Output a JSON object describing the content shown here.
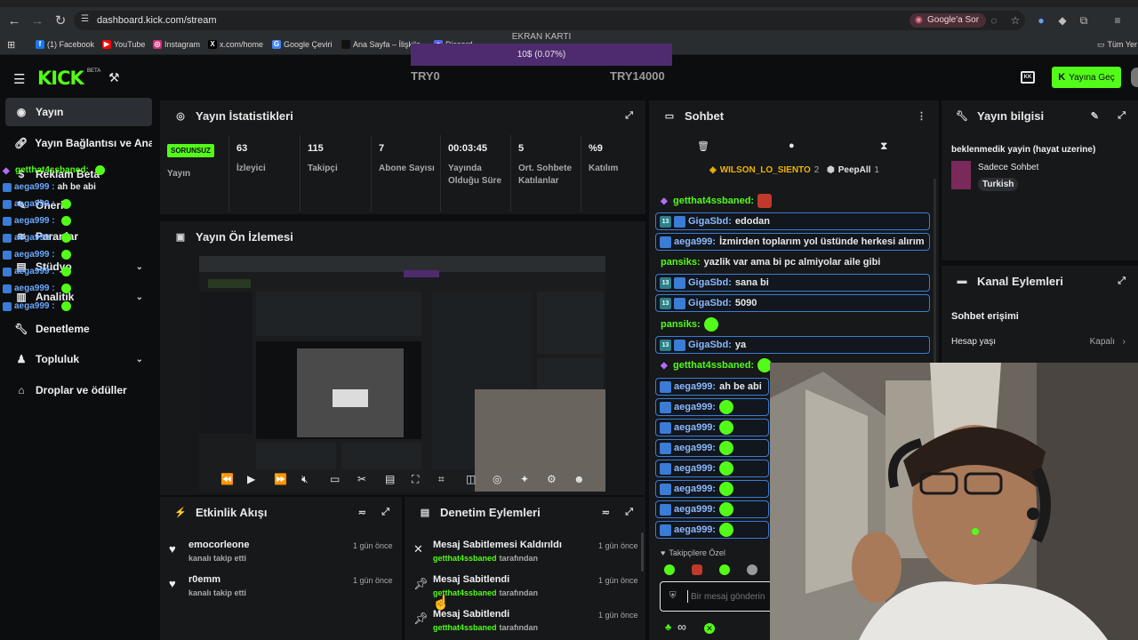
{
  "browser": {
    "url": "dashboard.kick.com/stream",
    "ask_google": "Google'a Sor",
    "bookmarks": [
      {
        "label": "(1) Facebook",
        "color": "#1877f2",
        "glyph": "f"
      },
      {
        "label": "YouTube",
        "color": "#ff0000",
        "glyph": "▶"
      },
      {
        "label": "Instagram",
        "color": "#d62976",
        "glyph": "◎"
      },
      {
        "label": "x.com/home",
        "color": "#000000",
        "glyph": "X"
      },
      {
        "label": "Google Çeviri",
        "color": "#4285f4",
        "glyph": "G"
      },
      {
        "label": "Ana Sayfa – İlişkile...",
        "color": "#111111",
        "glyph": ""
      },
      {
        "label": "Discord",
        "color": "#5865f2",
        "glyph": "●"
      }
    ],
    "all_bookmarks": "Tüm Yer"
  },
  "overlay": {
    "gpu_title": "EKRAN KARTI",
    "gpu_value": "10$ (0.07%)",
    "gpu_progress": 0.0007,
    "min": "TRY0",
    "max": "TRY14000"
  },
  "header": {
    "logo": "KICK",
    "beta": "BETA",
    "go_live": "Yayına Geç"
  },
  "sidebar": {
    "items": [
      {
        "label": "Yayın",
        "icon": "broadcast-icon"
      },
      {
        "label": "Yayın Bağlantısı ve Anahtarı",
        "icon": "link-icon"
      },
      {
        "label": "Reklam Beta",
        "icon": "ad-icon"
      },
      {
        "label": "Öneri",
        "icon": "bulb-icon"
      },
      {
        "label": "Paranlar",
        "icon": "money-icon"
      },
      {
        "label": "Stüdyo",
        "icon": "studio-icon"
      },
      {
        "label": "Analitik",
        "icon": "chart-icon"
      },
      {
        "label": "Denetleme",
        "icon": "wrench-icon"
      },
      {
        "label": "Topluluk",
        "icon": "people-icon"
      },
      {
        "label": "Droplar ve ödüller",
        "icon": "gift-icon"
      }
    ]
  },
  "overlay_chat": [
    {
      "user": "getthat4ssbaned:",
      "text": ""
    },
    {
      "user": "aega999 :",
      "text": "ah be abi"
    },
    {
      "user": "aega999 :",
      "text": ""
    },
    {
      "user": "aega999 :",
      "text": ""
    },
    {
      "user": "aega999 :",
      "text": ""
    },
    {
      "user": "aega999 :",
      "text": ""
    },
    {
      "user": "aega999 :",
      "text": ""
    },
    {
      "user": "aega999 :",
      "text": ""
    },
    {
      "user": "aega999 :",
      "text": ""
    }
  ],
  "stats": {
    "title": "Yayın İstatistikleri",
    "status_badge": "SORUNSUZ",
    "status_label": "Yayın",
    "items": [
      {
        "value": "63",
        "label": "İzleyici"
      },
      {
        "value": "115",
        "label": "Takipçi"
      },
      {
        "value": "7",
        "label": "Abone Sayısı"
      },
      {
        "value": "00:03:45",
        "label": "Yayında Olduğu Süre"
      },
      {
        "value": "5",
        "label": "Ort. Sohbete Katılanlar"
      },
      {
        "value": "%9",
        "label": "Katılım"
      }
    ]
  },
  "preview": {
    "title": "Yayın Ön İzlemesi"
  },
  "activity": {
    "title": "Etkinlik Akışı",
    "events": [
      {
        "name": "emocorleone",
        "action": "kanalı takip etti",
        "time": "1 gün önce"
      },
      {
        "name": "r0emm",
        "action": "kanalı takip etti",
        "time": "1 gün önce"
      }
    ]
  },
  "moderation": {
    "title": "Denetim Eylemleri",
    "events": [
      {
        "action": "Mesaj Sabitlemesi Kaldırıldı",
        "user": "getthat4ssbaned",
        "by": "tarafından",
        "time": "1 gün önce"
      },
      {
        "action": "Mesaj Sabitlendi",
        "user": "getthat4ssbaned",
        "by": "tarafından",
        "time": "1 gün önce"
      },
      {
        "action": "Mesaj Sabitlendi",
        "user": "getthat4ssbaned",
        "by": "tarafından",
        "time": "1 gün önce"
      }
    ]
  },
  "chat": {
    "title": "Sohbet",
    "top_users": [
      {
        "name": "WILSON_LO_SIENTO",
        "count": "2"
      },
      {
        "name": "PeepAll",
        "count": "1"
      }
    ],
    "messages": [
      {
        "user": "getthat4ssbaned:",
        "text": "",
        "style": "gem"
      },
      {
        "user": "GigaSbd:",
        "text": "edodan",
        "style": "boxed"
      },
      {
        "user": "aega999:",
        "text": "İzmirden toplarım yol üstünde herkesi alırım",
        "style": "boxed"
      },
      {
        "user": "pansiks:",
        "text": "yazlik var ama bi pc almiyolar aile gibi",
        "style": "plain"
      },
      {
        "user": "GigaSbd:",
        "text": "sana bi",
        "style": "boxed"
      },
      {
        "user": "GigaSbd:",
        "text": "5090",
        "style": "boxed"
      },
      {
        "user": "pansiks:",
        "text": "",
        "style": "plain"
      },
      {
        "user": "GigaSbd:",
        "text": "ya",
        "style": "boxed"
      },
      {
        "user": "getthat4ssbaned:",
        "text": "",
        "style": "gem"
      },
      {
        "user": "aega999:",
        "text": "ah be abi",
        "style": "boxed"
      },
      {
        "user": "aega999:",
        "text": "",
        "style": "boxed"
      },
      {
        "user": "aega999:",
        "text": "",
        "style": "boxed"
      },
      {
        "user": "aega999:",
        "text": "",
        "style": "boxed"
      },
      {
        "user": "aega999:",
        "text": "",
        "style": "boxed"
      },
      {
        "user": "aega999:",
        "text": "",
        "style": "boxed"
      },
      {
        "user": "aega999:",
        "text": "",
        "style": "boxed"
      },
      {
        "user": "aega999:",
        "text": "",
        "style": "boxed"
      }
    ],
    "followers_only": "Takipçilere Özel",
    "input_placeholder": "Bir mesaj gönderin",
    "infinity": "∞"
  },
  "stream_info": {
    "title": "Yayın bilgisi",
    "stream_title": "beklenmedik yayin (hayat uzerine)",
    "category": "Sadece Sohbet",
    "tag": "Turkish"
  },
  "channel_actions": {
    "title": "Kanal Eylemleri",
    "section": "Sohbet erişimi",
    "row_label": "Hesap yaşı",
    "row_value": "Kapalı"
  },
  "colors": {
    "accent": "#53fc18",
    "panel": "#16181a",
    "background": "#0b0d0e"
  }
}
